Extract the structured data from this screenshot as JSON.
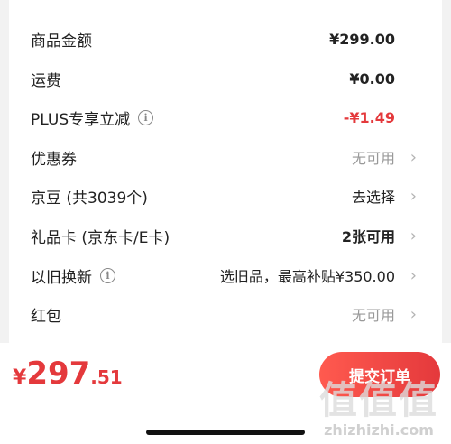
{
  "summary": {
    "rows": [
      {
        "label": "商品金额",
        "value": "¥299.00"
      },
      {
        "label": "运费",
        "value": "¥0.00"
      },
      {
        "label": "PLUS专享立减",
        "value": "-¥1.49"
      },
      {
        "label": "优惠券",
        "value": "无可用"
      },
      {
        "label": "京豆 (共3039个)",
        "value": "去选择"
      },
      {
        "label": "礼品卡 (京东卡/E卡)",
        "value": "2张可用"
      },
      {
        "label": "以旧换新",
        "value": "选旧品，最高补贴¥350.00"
      },
      {
        "label": "红包",
        "value": "无可用"
      }
    ],
    "info_glyph": "i",
    "chevron_glyph": "›"
  },
  "footer": {
    "currency": "¥",
    "total_int": "297",
    "total_dec": ".51",
    "submit_label": "提交订单"
  },
  "watermark": {
    "glyphs": "值值值",
    "text": "zhizhizhi.com"
  },
  "colors": {
    "accent": "#e4393c",
    "muted": "#999999",
    "background": "#f2f2f2"
  }
}
